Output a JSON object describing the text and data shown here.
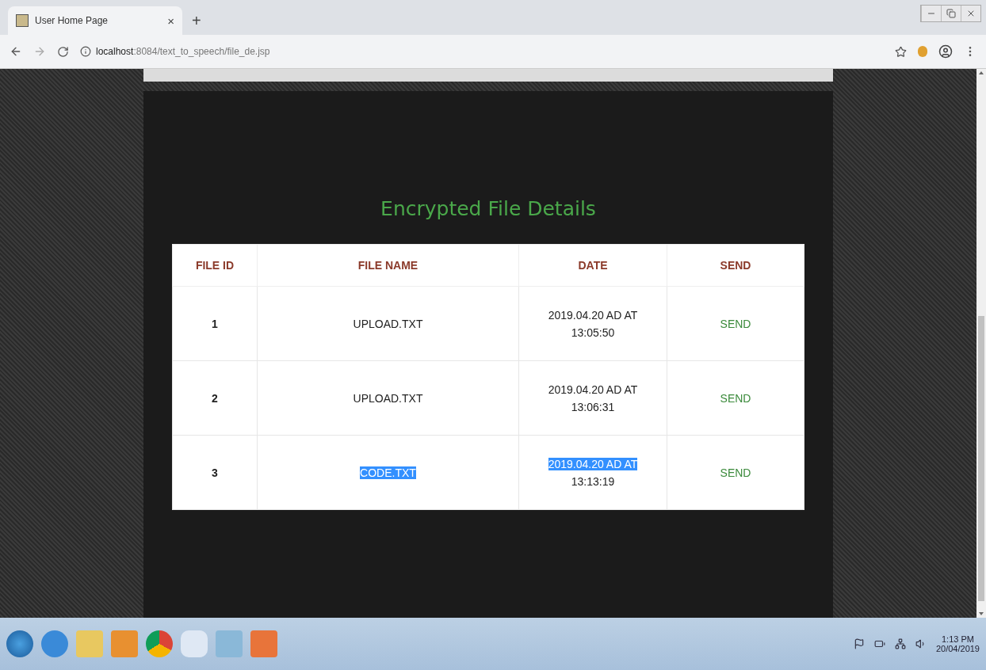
{
  "browser": {
    "tab_title": "User Home Page",
    "tab_close": "×",
    "new_tab": "+",
    "url_host": "localhost",
    "url_path": ":8084/text_to_speech/file_de.jsp"
  },
  "page": {
    "title": "Encrypted File Details",
    "columns": [
      "FILE ID",
      "FILE NAME",
      "DATE",
      "SEND"
    ],
    "rows": [
      {
        "id": "1",
        "name": "UPLOAD.TXT",
        "name_selected": false,
        "date": "2019.04.20 AD AT",
        "date_selected": false,
        "time": "13:05:50",
        "send": "SEND"
      },
      {
        "id": "2",
        "name": "UPLOAD.TXT",
        "name_selected": false,
        "date": "2019.04.20 AD AT",
        "date_selected": false,
        "time": "13:06:31",
        "send": "SEND"
      },
      {
        "id": "3",
        "name": "CODE.TXT",
        "name_selected": true,
        "date": "2019.04.20 AD AT",
        "date_selected": true,
        "time": "13:13:19",
        "send": "SEND"
      }
    ]
  },
  "taskbar": {
    "clock_time": "1:13 PM",
    "clock_date": "20/04/2019"
  }
}
